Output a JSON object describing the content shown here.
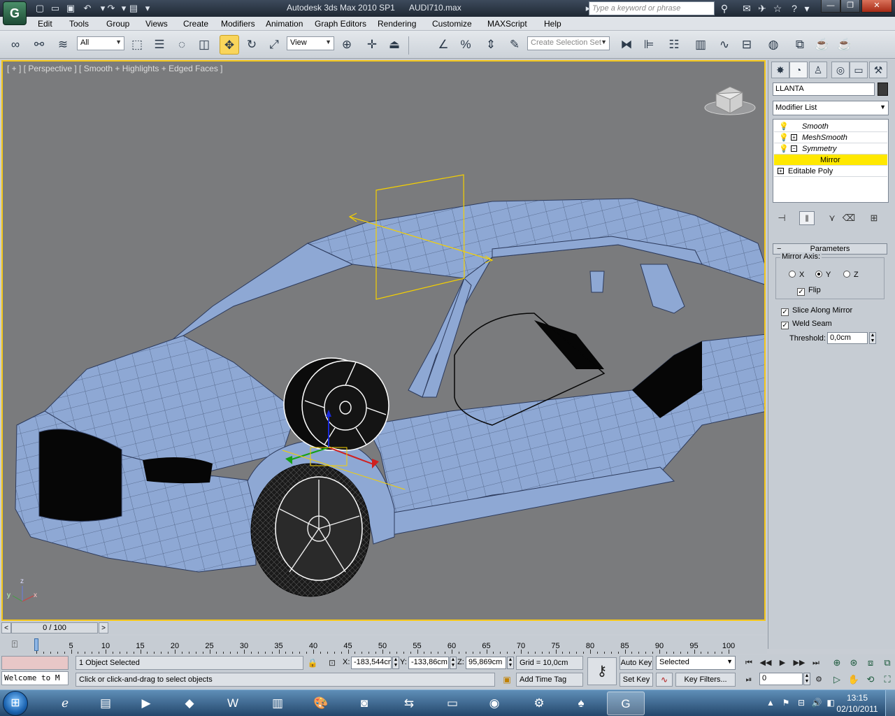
{
  "titlebar": {
    "app_title": "Autodesk 3ds Max  2010 SP1",
    "file_name": "AUDI710.max",
    "search_placeholder": "Type a keyword or phrase"
  },
  "menu": [
    "Edit",
    "Tools",
    "Group",
    "Views",
    "Create",
    "Modifiers",
    "Animation",
    "Graph Editors",
    "Rendering",
    "Customize",
    "MAXScript",
    "Help"
  ],
  "toolbar": {
    "selection_filter": "All",
    "ref_coord_system": "View",
    "selection_set_placeholder": "Create Selection Set"
  },
  "viewport": {
    "label": "[ + ] [ Perspective ] [ Smooth + Highlights + Edged Faces ]",
    "axis_z": "z",
    "axis_x": "x",
    "axis_y": "y"
  },
  "command_panel": {
    "object_name": "LLANTA",
    "object_color": "#3a3a3a",
    "modifier_list": "Modifier List",
    "stack": [
      {
        "label": "Smooth",
        "expanded": null
      },
      {
        "label": "MeshSmooth",
        "expanded": false
      },
      {
        "label": "Symmetry",
        "expanded": true
      },
      {
        "label": "Mirror",
        "sub": true,
        "selected": true
      },
      {
        "label": "Editable Poly",
        "expanded": false
      }
    ],
    "params": {
      "title": "Parameters",
      "mirror_axis_label": "Mirror Axis:",
      "axis_x": "X",
      "axis_y": "Y",
      "axis_z": "Z",
      "selected_axis": "Y",
      "flip_label": "Flip",
      "flip": true,
      "slice_label": "Slice Along Mirror",
      "slice": true,
      "weld_label": "Weld Seam",
      "weld": true,
      "threshold_label": "Threshold:",
      "threshold": "0,0cm"
    }
  },
  "timeline": {
    "slider_label": "0 / 100",
    "current_frame_fraction": 0,
    "ticks": [
      "0",
      "5",
      "10",
      "15",
      "20",
      "25",
      "30",
      "35",
      "40",
      "45",
      "50",
      "55",
      "60",
      "65",
      "70",
      "75",
      "80",
      "85",
      "90",
      "95",
      "100"
    ]
  },
  "status": {
    "maxscript_text": "Welcome to M",
    "selection": "1 Object Selected",
    "prompt": "Click or click-and-drag to select objects",
    "x_label": "X:",
    "x": "-183,544cm",
    "y_label": "Y:",
    "y": "-133,86cm",
    "z_label": "Z:",
    "z": "95,869cm",
    "grid": "Grid = 10,0cm",
    "add_time_tag": "Add Time Tag",
    "auto_key": "Auto Key",
    "set_key": "Set Key",
    "key_mode": "Selected",
    "key_filters": "Key Filters...",
    "frame": "0"
  },
  "taskbar": {
    "time": "13:15",
    "date": "02/10/2011"
  },
  "colors": {
    "viewport_bg": "#7a7b7d",
    "viewport_border": "#f5c71a",
    "mesh": "#8ea8d4",
    "stack_highlight": "#ffe800"
  }
}
